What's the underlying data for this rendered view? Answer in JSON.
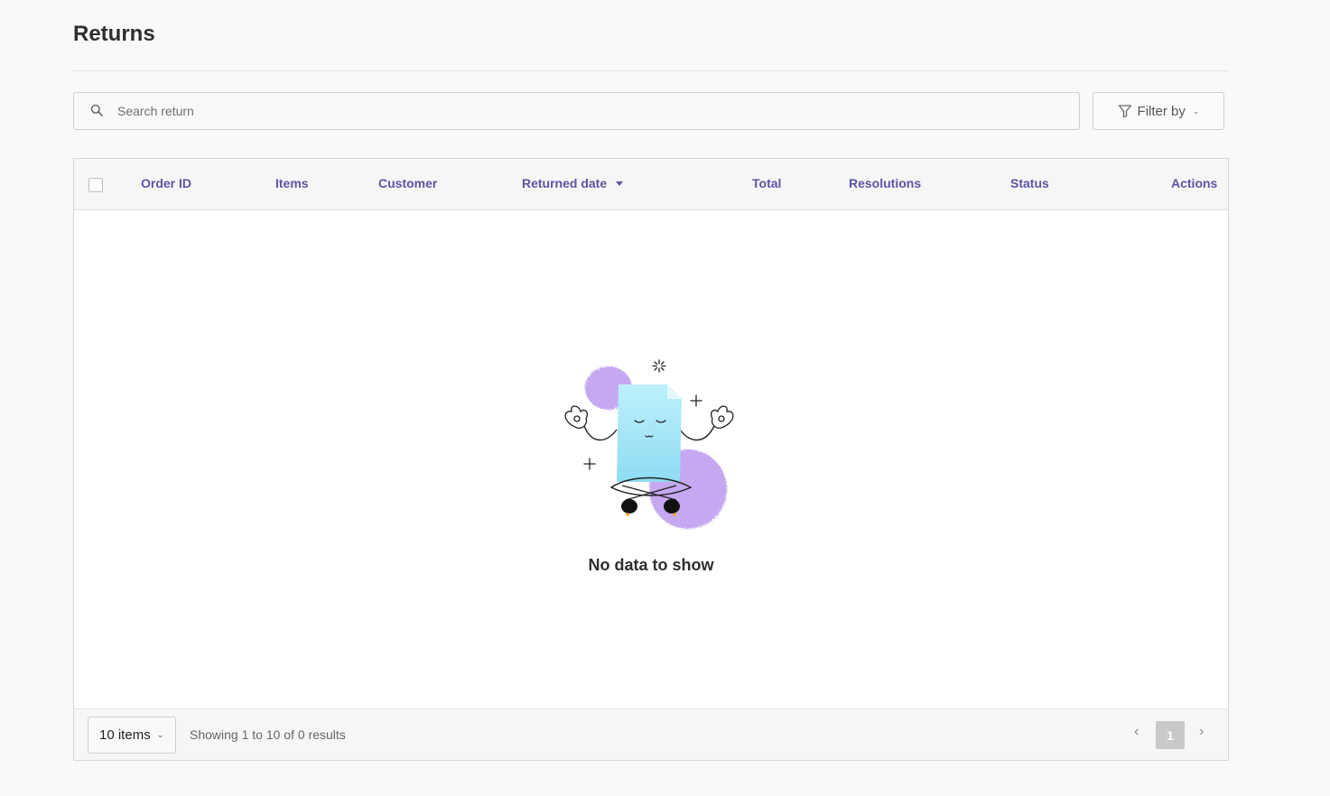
{
  "page": {
    "title": "Returns"
  },
  "search": {
    "placeholder": "Search return",
    "icon": "search-icon"
  },
  "filter": {
    "label": "Filter by",
    "icon": "filter-icon"
  },
  "table": {
    "columns": [
      {
        "key": "order_id",
        "label": "Order ID"
      },
      {
        "key": "items",
        "label": "Items"
      },
      {
        "key": "customer",
        "label": "Customer"
      },
      {
        "key": "returned_date",
        "label": "Returned date",
        "sorted": "desc"
      },
      {
        "key": "total",
        "label": "Total"
      },
      {
        "key": "resolutions",
        "label": "Resolutions"
      },
      {
        "key": "status",
        "label": "Status"
      },
      {
        "key": "actions",
        "label": "Actions"
      }
    ],
    "rows": [],
    "empty_message": "No data to show"
  },
  "footer": {
    "page_size_label": "10 items",
    "results_text": "Showing 1 to 10 of 0 results",
    "current_page": "1",
    "prev_symbol": "‹",
    "next_symbol": "›"
  },
  "colors": {
    "accent": "#5a55a4",
    "illustration_purple": "#c6a8f0",
    "illustration_blue": "#a8e8f6"
  }
}
